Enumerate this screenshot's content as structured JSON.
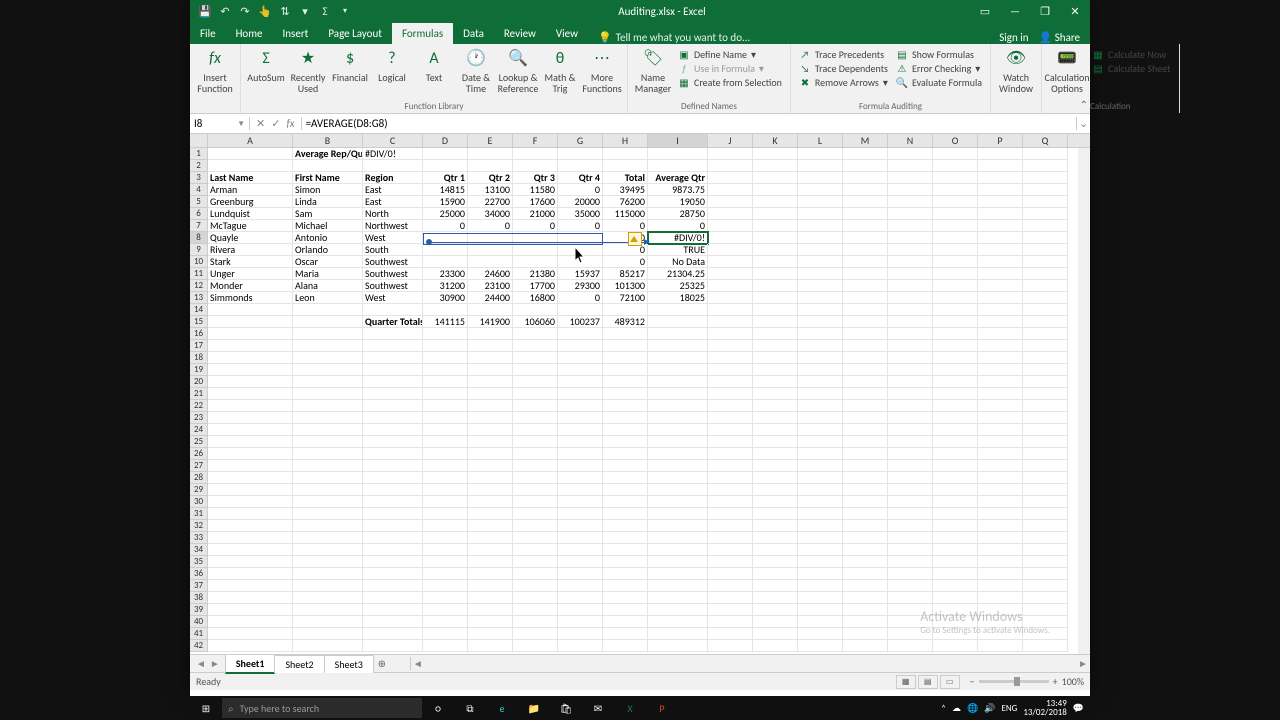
{
  "window": {
    "title": "Auditing.xlsx - Excel"
  },
  "qat": {
    "save": "save-icon",
    "undo": "undo-icon",
    "redo": "redo-icon",
    "touch": "touch-icon",
    "sort": "sort-icon",
    "filter": "filter-icon",
    "sum": "sum-icon"
  },
  "tabs": {
    "file": "File",
    "home": "Home",
    "insert": "Insert",
    "pagelayout": "Page Layout",
    "formulas": "Formulas",
    "data": "Data",
    "review": "Review",
    "view": "View",
    "tellme": "Tell me what you want to do...",
    "signin": "Sign in",
    "share": "Share"
  },
  "ribbon": {
    "insert_function": "Insert Function",
    "autosum": "AutoSum",
    "recently": "Recently Used",
    "financial": "Financial",
    "logical": "Logical",
    "text": "Text",
    "datetime": "Date & Time",
    "lookup": "Lookup & Reference",
    "mathtrig": "Math & Trig",
    "more": "More Functions",
    "library_label": "Function Library",
    "name_manager": "Name Manager",
    "define_name": "Define Name",
    "use_in_formula": "Use in Formula",
    "create_from_sel": "Create from Selection",
    "defined_names_label": "Defined Names",
    "trace_prec": "Trace Precedents",
    "trace_dep": "Trace Dependents",
    "remove_arrows": "Remove Arrows",
    "show_formulas": "Show Formulas",
    "error_check": "Error Checking",
    "eval_formula": "Evaluate Formula",
    "auditing_label": "Formula Auditing",
    "watch_window": "Watch Window",
    "calc_options": "Calculation Options",
    "calc_now": "Calculate Now",
    "calc_sheet": "Calculate Sheet",
    "calc_label": "Calculation"
  },
  "formulabar": {
    "namebox": "I8",
    "formula": "=AVERAGE(D8:G8)"
  },
  "columns": [
    "A",
    "B",
    "C",
    "D",
    "E",
    "F",
    "G",
    "H",
    "I",
    "J",
    "K",
    "L",
    "M",
    "N",
    "O",
    "P",
    "Q"
  ],
  "headers": {
    "r1_label": "Average Rep/Quarter:",
    "r1_val": "#DIV/0!",
    "lastname": "Last Name",
    "firstname": "First Name",
    "region": "Region",
    "q1": "Qtr 1",
    "q2": "Qtr 2",
    "q3": "Qtr 3",
    "q4": "Qtr 4",
    "total": "Total",
    "avg": "Average Qtr"
  },
  "rows": [
    {
      "r": 4,
      "ln": "Arman",
      "fn": "Simon",
      "rg": "East",
      "d": "14815",
      "e": "13100",
      "f": "11580",
      "g": "0",
      "h": "39495",
      "i": "9873.75"
    },
    {
      "r": 5,
      "ln": "Greenburg",
      "fn": "Linda",
      "rg": "East",
      "d": "15900",
      "e": "22700",
      "f": "17600",
      "g": "20000",
      "h": "76200",
      "i": "19050"
    },
    {
      "r": 6,
      "ln": "Lundquist",
      "fn": "Sam",
      "rg": "North",
      "d": "25000",
      "e": "34000",
      "f": "21000",
      "g": "35000",
      "h": "115000",
      "i": "28750"
    },
    {
      "r": 7,
      "ln": "McTague",
      "fn": "Michael",
      "rg": "Northwest",
      "d": "0",
      "e": "0",
      "f": "0",
      "g": "0",
      "h": "0",
      "i": "0"
    },
    {
      "r": 8,
      "ln": "Quayle",
      "fn": "Antonio",
      "rg": "West",
      "d": "",
      "e": "",
      "f": "",
      "g": "",
      "h": "0",
      "i": "#DIV/0!"
    },
    {
      "r": 9,
      "ln": "Rivera",
      "fn": "Orlando",
      "rg": "South",
      "d": "",
      "e": "",
      "f": "",
      "g": "",
      "h": "0",
      "i": "TRUE"
    },
    {
      "r": 10,
      "ln": "Stark",
      "fn": "Oscar",
      "rg": "Southwest",
      "d": "",
      "e": "",
      "f": "",
      "g": "",
      "h": "0",
      "i": "No Data"
    },
    {
      "r": 11,
      "ln": "Unger",
      "fn": "Maria",
      "rg": "Southwest",
      "d": "23300",
      "e": "24600",
      "f": "21380",
      "g": "15937",
      "h": "85217",
      "i": "21304.25"
    },
    {
      "r": 12,
      "ln": "Monder",
      "fn": "Alana",
      "rg": "Southwest",
      "d": "31200",
      "e": "23100",
      "f": "17700",
      "g": "29300",
      "h": "101300",
      "i": "25325"
    },
    {
      "r": 13,
      "ln": "Simmonds",
      "fn": "Leon",
      "rg": "West",
      "d": "30900",
      "e": "24400",
      "f": "16800",
      "g": "0",
      "h": "72100",
      "i": "18025"
    }
  ],
  "totals": {
    "label": "Quarter Totals:",
    "d": "141115",
    "e": "141900",
    "f": "106060",
    "g": "100237",
    "h": "489312"
  },
  "sheets": {
    "s1": "Sheet1",
    "s2": "Sheet2",
    "s3": "Sheet3"
  },
  "status": {
    "ready": "Ready",
    "zoom": "100%"
  },
  "watermark": {
    "title": "Activate Windows",
    "sub": "Go to Settings to activate Windows."
  },
  "taskbar": {
    "search": "Type here to search",
    "lang": "ENG",
    "time": "13:49",
    "date": "13/02/2018"
  }
}
